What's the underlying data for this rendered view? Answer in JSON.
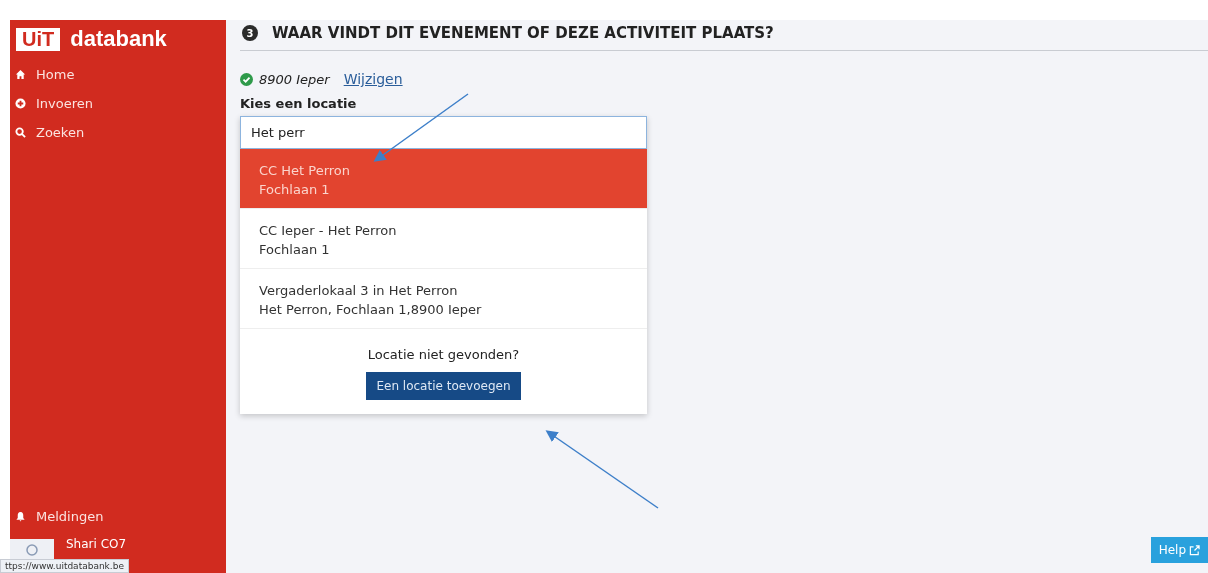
{
  "sidebar": {
    "logo": {
      "badge": "UiT",
      "name": "databank"
    },
    "nav": [
      {
        "kind": "home",
        "label": "Home"
      },
      {
        "kind": "add",
        "label": "Invoeren"
      },
      {
        "kind": "search",
        "label": "Zoeken"
      }
    ],
    "notifications": {
      "label": "Meldingen"
    },
    "user": {
      "name": "Shari CO7"
    }
  },
  "section": {
    "step": "3",
    "title": "WAAR VINDT DIT EVENEMENT OF DEZE ACTIVITEIT PLAATS?"
  },
  "city": {
    "name": "8900 Ieper",
    "change_link": "Wijzigen"
  },
  "location": {
    "label": "Kies een locatie",
    "value": "Het perr",
    "suggestions": [
      {
        "name": "CC Het Perron",
        "address": "Fochlaan 1",
        "selected": true
      },
      {
        "name": "CC Ieper - Het Perron",
        "address": "Fochlaan 1",
        "selected": false
      },
      {
        "name": "Vergaderlokaal 3 in Het Perron",
        "address": "Het Perron, Fochlaan 1,8900 Ieper",
        "selected": false
      }
    ],
    "not_found": "Locatie niet gevonden?",
    "add_button": "Een locatie toevoegen"
  },
  "help_button": "Help",
  "status_url": "ttps://www.uitdatabank.be"
}
